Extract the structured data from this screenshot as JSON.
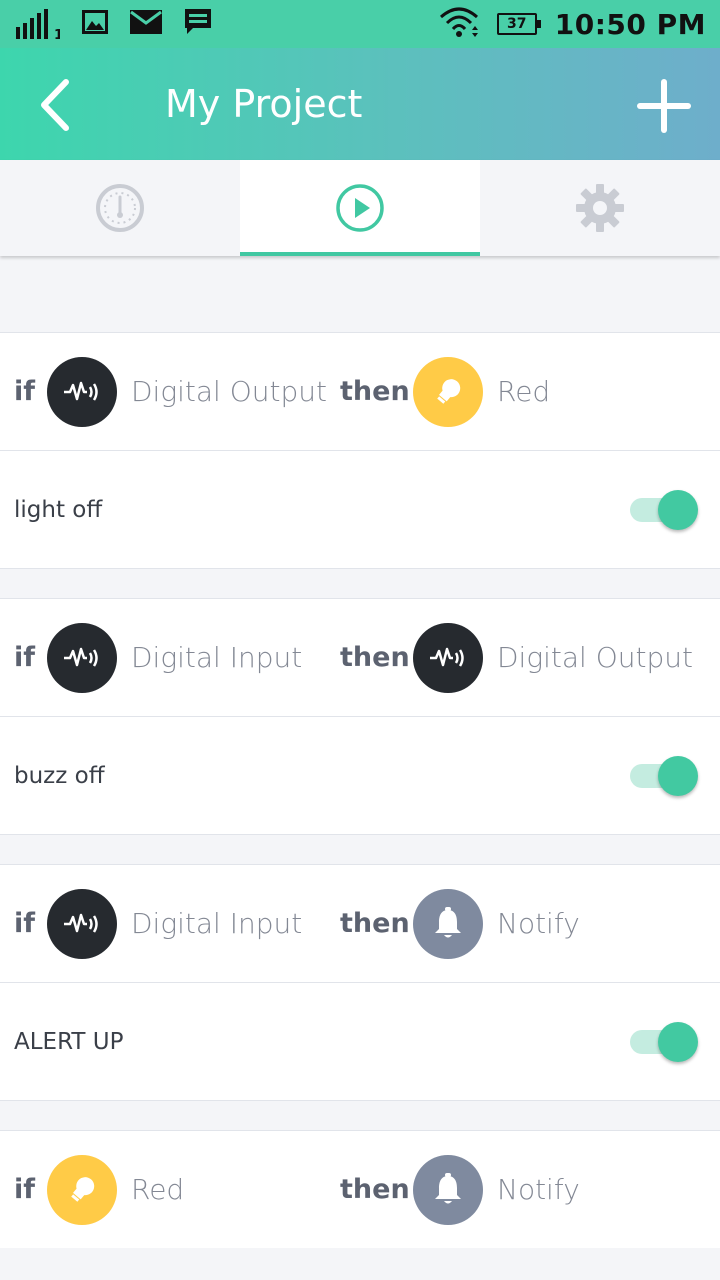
{
  "status_bar": {
    "signal_label": "1",
    "battery": "37",
    "time": "10:50 PM"
  },
  "app_bar": {
    "title": "My Project"
  },
  "tabs": [
    {
      "icon": "gauge-icon",
      "active": false
    },
    {
      "icon": "play-icon",
      "active": true
    },
    {
      "icon": "gear-icon",
      "active": false
    }
  ],
  "rules": [
    {
      "if_keyword": "if",
      "if_source": "Digital Output",
      "if_icon": "waveform-icon",
      "then_keyword": "then",
      "then_action": "Red",
      "then_icon": "bulb-icon",
      "name": "light off",
      "enabled": true
    },
    {
      "if_keyword": "if",
      "if_source": "Digital Input",
      "if_icon": "waveform-icon",
      "then_keyword": "then",
      "then_action": "Digital Output",
      "then_icon": "waveform-icon",
      "name": "buzz off",
      "enabled": true
    },
    {
      "if_keyword": "if",
      "if_source": "Digital Input",
      "if_icon": "waveform-icon",
      "then_keyword": "then",
      "then_action": "Notify",
      "then_icon": "bell-icon",
      "name": "ALERT UP",
      "enabled": true
    },
    {
      "if_keyword": "if",
      "if_source": "Red",
      "if_icon": "bulb-icon",
      "then_keyword": "then",
      "then_action": "Notify",
      "then_icon": "bell-icon"
    }
  ],
  "colors": {
    "accent": "#42c9a1",
    "header_start": "#3dd6ad",
    "header_end": "#6eaecb",
    "icon_dark": "#262a2f",
    "icon_yellow": "#ffcb47",
    "icon_gray": "#7f8a9f"
  }
}
